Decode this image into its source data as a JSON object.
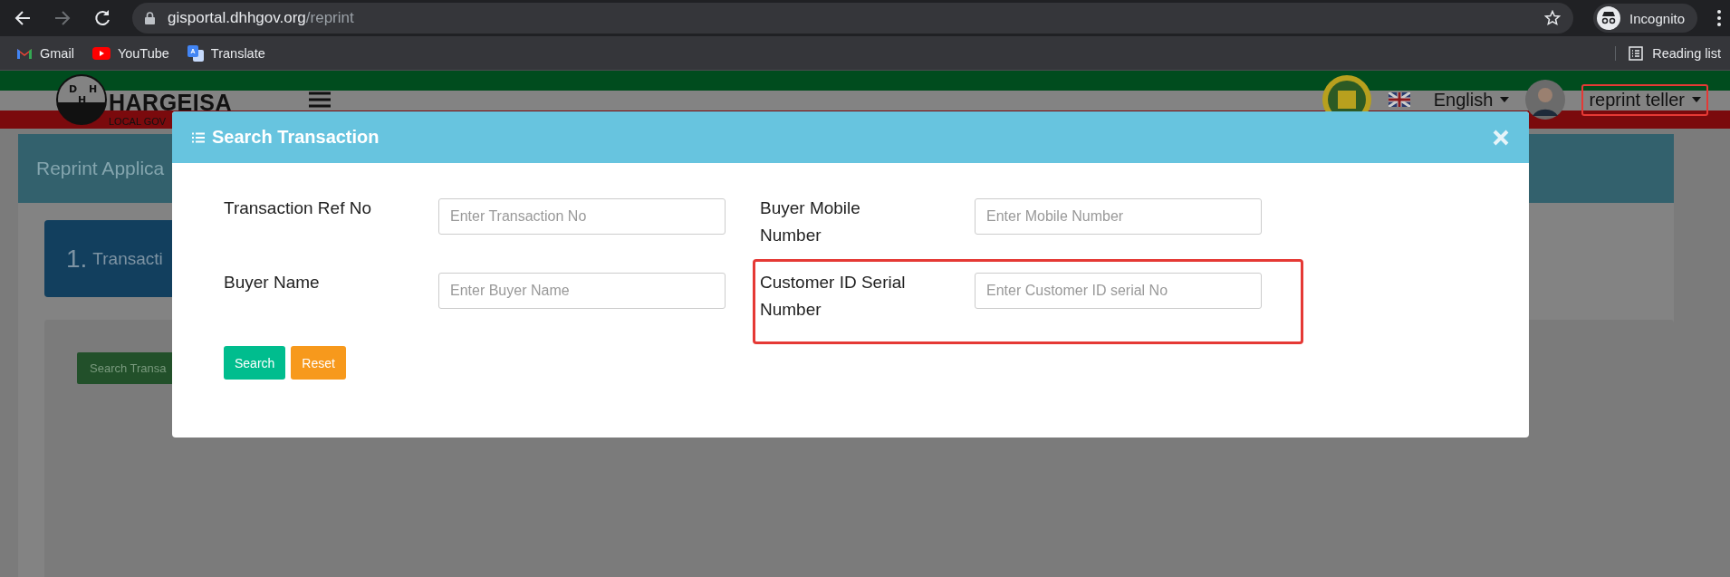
{
  "browser": {
    "url_host": "gisportal.dhhgov.org",
    "url_path": "/reprint",
    "forward_disabled": true,
    "profile": "Incognito",
    "bookmarks": [
      {
        "label": "Gmail",
        "kind": "gmail"
      },
      {
        "label": "YouTube",
        "kind": "youtube"
      },
      {
        "label": "Translate",
        "kind": "translate"
      }
    ],
    "reading_list": "Reading list"
  },
  "header": {
    "logo_letters": [
      "D",
      "H",
      "H"
    ],
    "logo_title": "HARGEISA",
    "logo_subtitle": "LOCAL GOV",
    "language": "English",
    "user": "reprint teller",
    "user_highlighted": true
  },
  "background": {
    "page_title": "Reprint Applica",
    "step_number": "1.",
    "step_title": "Transacti",
    "button": "Search Transa"
  },
  "modal": {
    "title": "Search Transaction",
    "fields": [
      {
        "label": "Transaction Ref No",
        "placeholder": "Enter Transaction No",
        "highlighted": false
      },
      {
        "label": "Buyer Mobile Number",
        "placeholder": "Enter Mobile Number",
        "highlighted": false
      },
      {
        "label": "Buyer Name",
        "placeholder": "Enter Buyer Name",
        "highlighted": false
      },
      {
        "label": "Customer ID Serial Number",
        "placeholder": "Enter Customer ID serial No",
        "highlighted": true
      }
    ],
    "buttons": [
      {
        "label": "Search",
        "kind": "primary"
      },
      {
        "label": "Reset",
        "kind": "warning"
      }
    ]
  }
}
